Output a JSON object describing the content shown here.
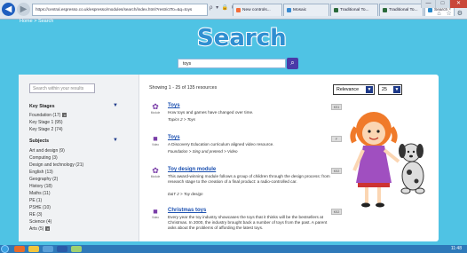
{
  "browser": {
    "url": "https://central.espresso.co.uk/espresso/modules/search/index.html?restrictTo=&q=toys",
    "address_controls": "ρ ▾ 🔒 C",
    "tabs": [
      {
        "label": "New controls...",
        "active": false
      },
      {
        "label": "Mosaic",
        "active": false
      },
      {
        "label": "Traditional To...",
        "active": false
      },
      {
        "label": "Traditional To...",
        "active": false
      },
      {
        "label": "Search",
        "active": true
      }
    ],
    "window_buttons": [
      "—",
      "□",
      "✕"
    ],
    "toolbar_icons": "⌂ ☆ ⚙"
  },
  "breadcrumb": "Home > Search",
  "page_title": "Search",
  "search": {
    "value": "toys",
    "button_icon": "search-icon"
  },
  "sidebar": {
    "filter_placeholder": "Search within your results",
    "key_stages_heading": "Key Stages",
    "key_stages": [
      {
        "label": "Foundation (17)",
        "removable": true
      },
      {
        "label": "Key Stage 1 (95)",
        "removable": false
      },
      {
        "label": "Key Stage 2 (74)",
        "removable": false
      }
    ],
    "subjects_heading": "Subjects",
    "subjects": [
      {
        "label": "Art and design (9)",
        "removable": false
      },
      {
        "label": "Computing (3)",
        "removable": false
      },
      {
        "label": "Design and technology (21)",
        "removable": false
      },
      {
        "label": "English (13)",
        "removable": false
      },
      {
        "label": "Geography (2)",
        "removable": false
      },
      {
        "label": "History (18)",
        "removable": false
      },
      {
        "label": "Maths (11)",
        "removable": false
      },
      {
        "label": "PE (1)",
        "removable": false
      },
      {
        "label": "PSHE (10)",
        "removable": false
      },
      {
        "label": "RE (3)",
        "removable": false
      },
      {
        "label": "Science (4)",
        "removable": false
      },
      {
        "label": "Arts (5)",
        "removable": true
      }
    ]
  },
  "results_header": {
    "showing": "Showing 1 - 25 of 135 resources",
    "sort_value": "Relevance",
    "per_page_value": "25"
  },
  "results": [
    {
      "type": "Module",
      "title": "Toys",
      "description": "How toys and games have changed over time.",
      "crumb": "Topics 2 > Toys",
      "badge": "KS1"
    },
    {
      "type": "Video",
      "title": "Toys",
      "description": "A Discovery Education curriculum aligned video resource.",
      "crumb": "Foundation > Sing and pretend > Video",
      "badge": "F"
    },
    {
      "type": "Module",
      "title": "Toy design module",
      "description": "This award-winning module follows a group of children through the design process: from research stage to the creation of a final product: a radio-controlled car.",
      "crumb": "D&T 2 > Toy design",
      "badge": "KS2"
    },
    {
      "type": "Video",
      "title": "Christmas toys",
      "description": "Every year the toy industry showcases the toys that it thinks will be the bestsellers at Christmas. In 2000, the industry brought back a number of toys from the past. A parent asks about the problems of affording the latest toys.",
      "crumb": "",
      "badge": "KS2"
    }
  ],
  "taskbar": {
    "clock": "11:48"
  }
}
